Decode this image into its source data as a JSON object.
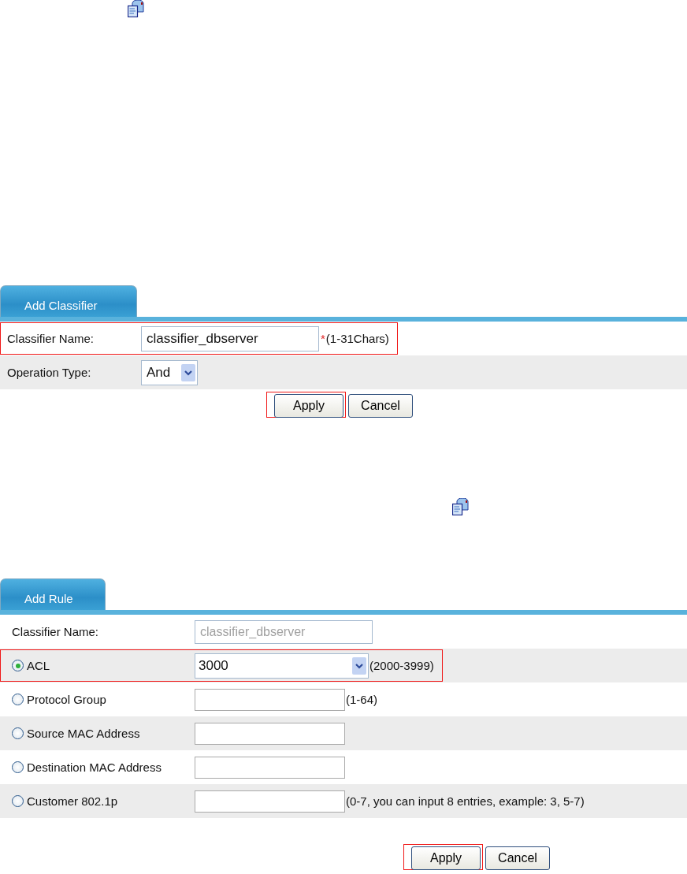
{
  "sections": [
    {
      "tab": {
        "label": "Add Classifier",
        "selected": true
      },
      "rows": [
        {
          "kind": "text",
          "label": "Classifier Name:",
          "value": "classifier_dbserver",
          "required_mark": "*",
          "hint": "(1-31Chars)",
          "highlighted": true
        },
        {
          "kind": "select",
          "label": "Operation Type:",
          "value": "And",
          "highlighted": false
        }
      ],
      "buttons": [
        {
          "label": "Apply",
          "highlighted": true
        },
        {
          "label": "Cancel",
          "highlighted": false
        }
      ]
    },
    {
      "tab": {
        "label": "Add Rule",
        "selected": true
      },
      "rows": [
        {
          "kind": "text",
          "label": "Classifier Name:",
          "value": "classifier_dbserver",
          "disabled": true,
          "highlighted": false
        },
        {
          "kind": "radio-combo",
          "label": "ACL",
          "selected": true,
          "value": "3000",
          "hint": "(2000-3999)",
          "highlighted": true
        },
        {
          "kind": "radio-text",
          "label": "Protocol Group",
          "selected": false,
          "hint": "(1-64)",
          "highlighted": false
        },
        {
          "kind": "radio-text",
          "label": "Source MAC Address",
          "selected": false,
          "highlighted": false
        },
        {
          "kind": "radio-text",
          "label": "Destination MAC Address",
          "selected": false,
          "highlighted": false
        },
        {
          "kind": "radio-text",
          "label": "Customer 802.1p",
          "selected": false,
          "hint": "(0-7, you can input 8 entries, example: 3, 5-7)",
          "highlighted": false
        }
      ],
      "buttons": [
        {
          "label": "Apply",
          "highlighted": true
        },
        {
          "label": "Cancel",
          "highlighted": false
        }
      ]
    }
  ]
}
